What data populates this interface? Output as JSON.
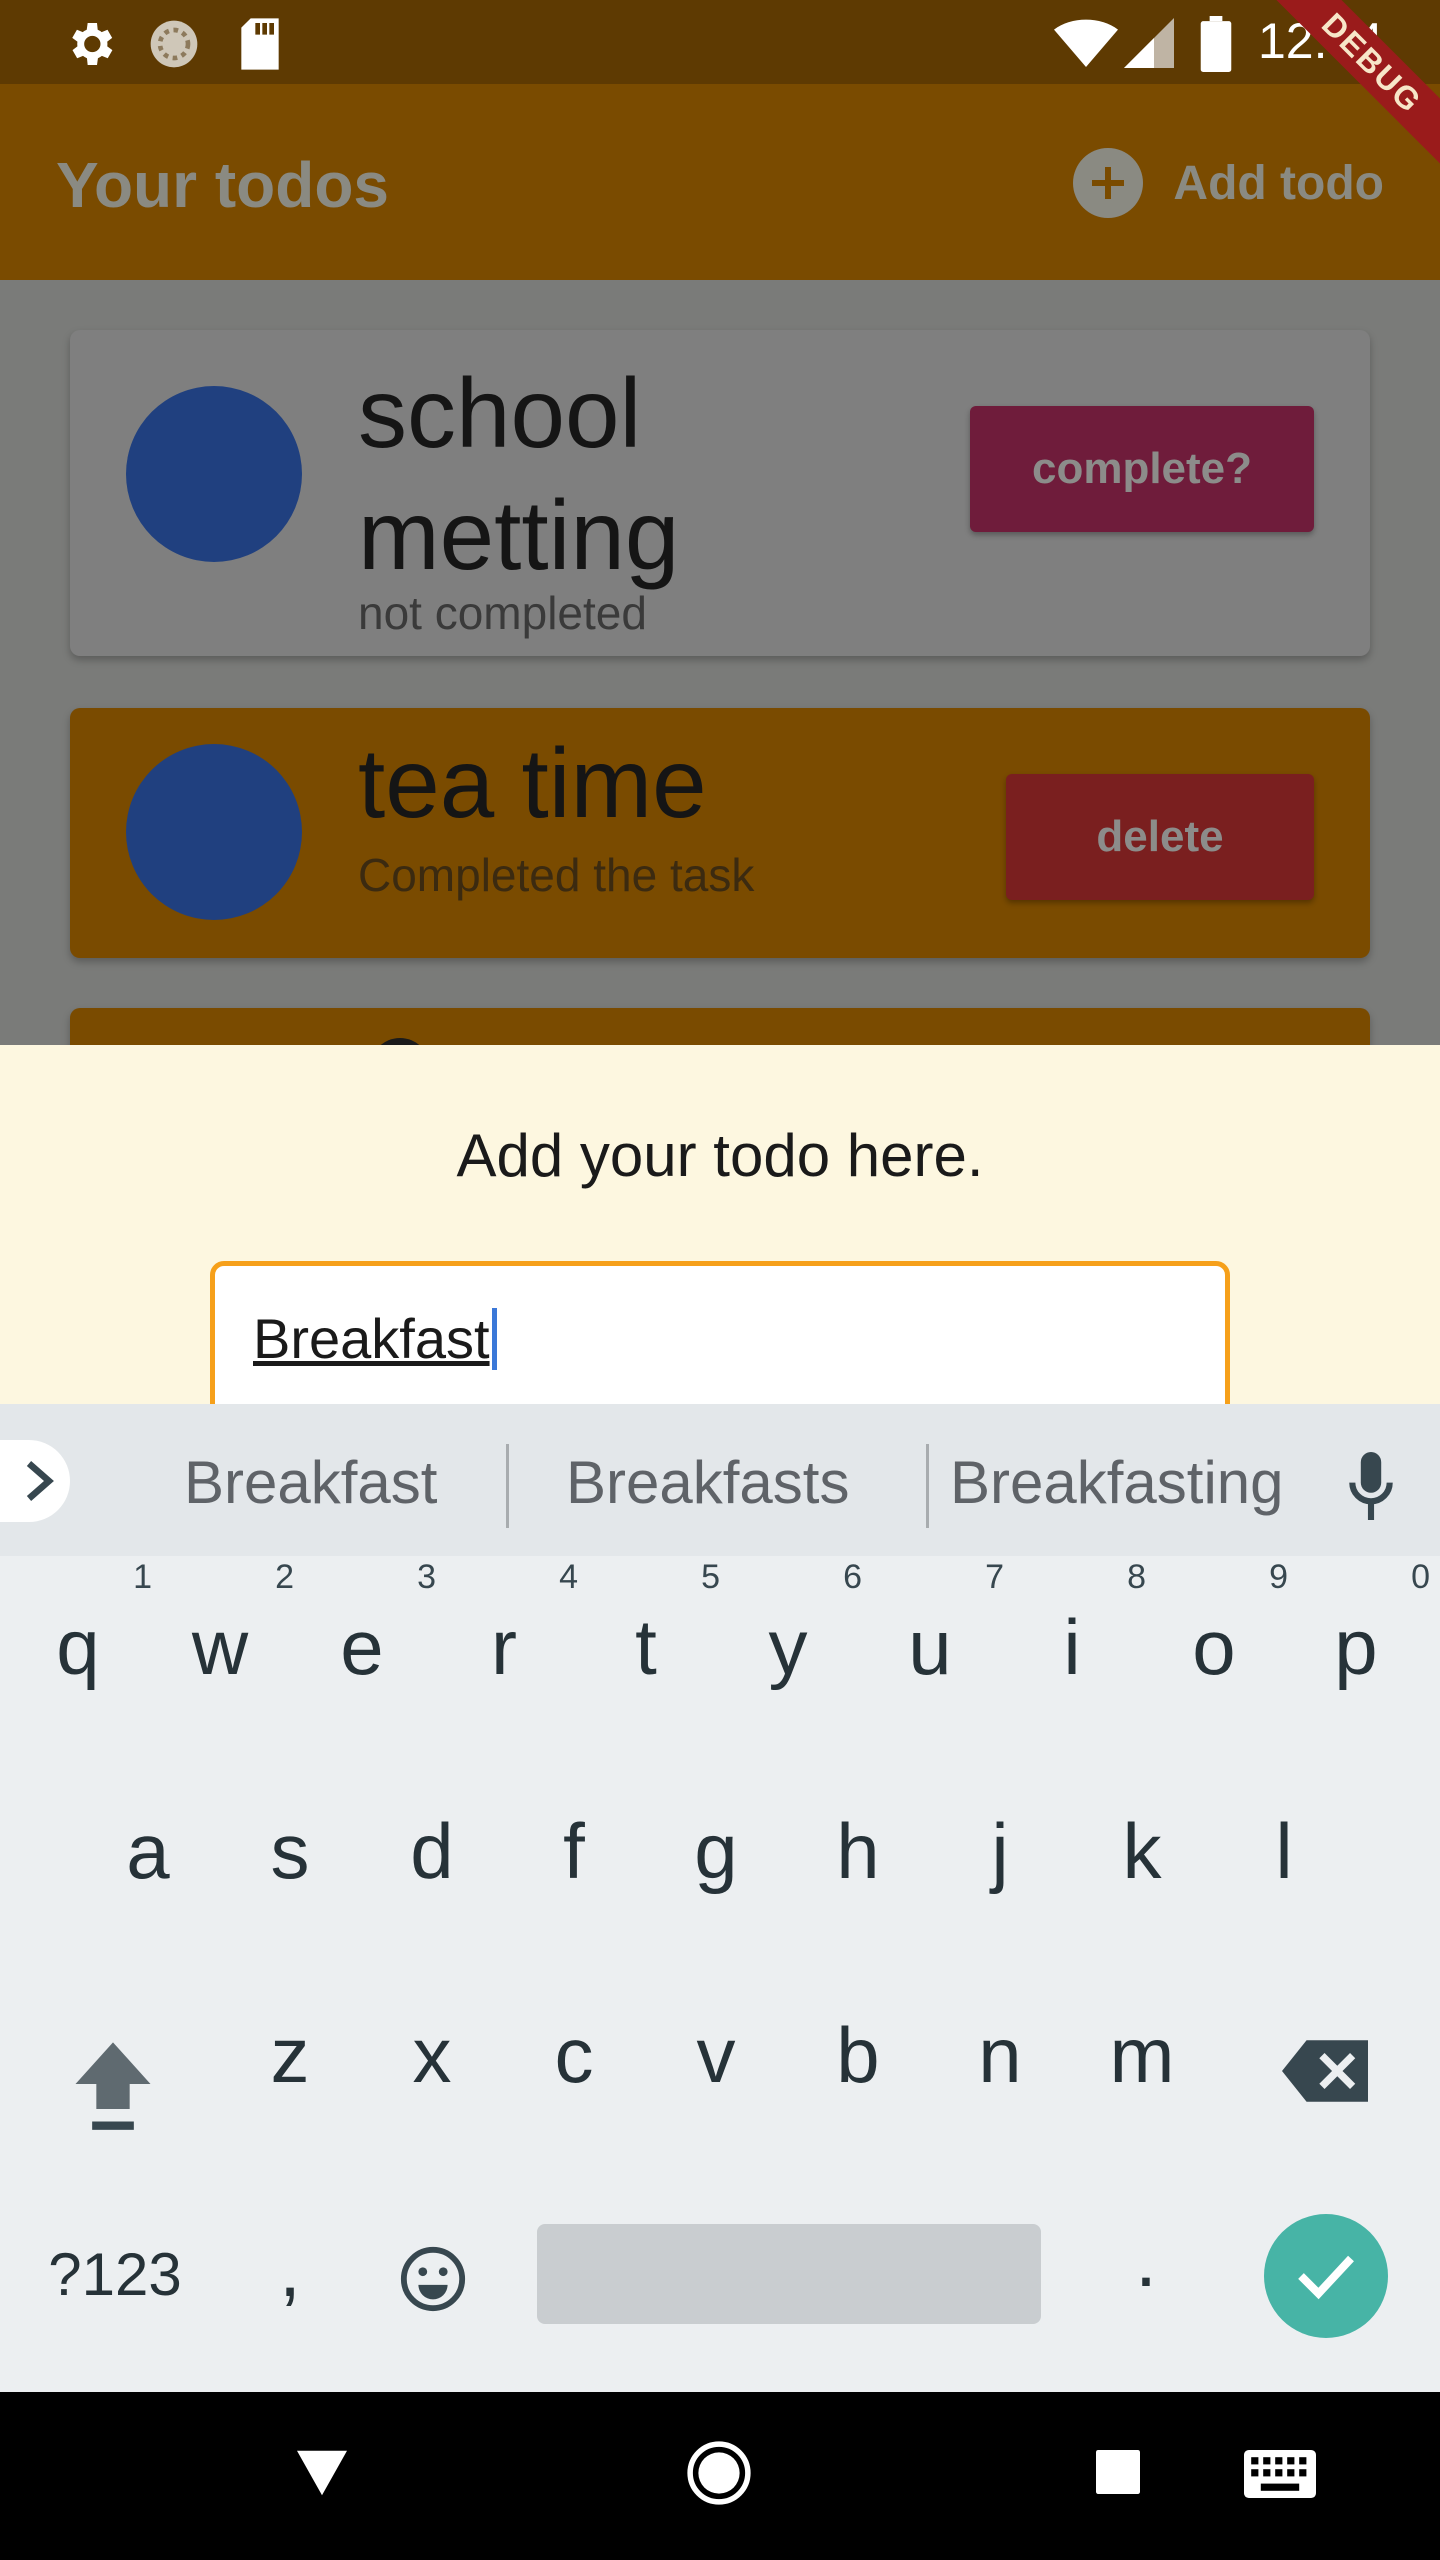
{
  "status_bar": {
    "time": "12:44",
    "icons": [
      "gear-icon",
      "sync-icon",
      "sd-card-icon",
      "wifi-icon",
      "signal-icon",
      "battery-icon"
    ]
  },
  "debug_banner": "DEBUG",
  "app_bar": {
    "title": "Your todos",
    "add_label": "Add todo"
  },
  "todos": [
    {
      "title": "school metting",
      "status": "not completed",
      "action": "complete?"
    },
    {
      "title": "tea time",
      "status": "Completed the task",
      "action": "delete"
    }
  ],
  "sheet": {
    "title": "Add your todo here.",
    "input_value": "Breakfast"
  },
  "keyboard": {
    "suggestions": [
      "Breakfast",
      "Breakfasts",
      "Breakfasting"
    ],
    "row1": [
      "q",
      "w",
      "e",
      "r",
      "t",
      "y",
      "u",
      "i",
      "o",
      "p"
    ],
    "row1_nums": [
      "1",
      "2",
      "3",
      "4",
      "5",
      "6",
      "7",
      "8",
      "9",
      "0"
    ],
    "row2": [
      "a",
      "s",
      "d",
      "f",
      "g",
      "h",
      "j",
      "k",
      "l"
    ],
    "row3": [
      "z",
      "x",
      "c",
      "v",
      "b",
      "n",
      "m"
    ],
    "symbols_key": "?123",
    "comma_key": ",",
    "period_key": "."
  },
  "colors": {
    "app_bar": "#7a4b00",
    "status_bar": "#5e3a02",
    "avatar": "#20407f",
    "complete_button": "#6f1c3b",
    "delete_button": "#7a1f1f",
    "sheet_bg": "#fdf7e0",
    "input_border": "#f6a01a",
    "enter_key": "#47b4a6"
  }
}
